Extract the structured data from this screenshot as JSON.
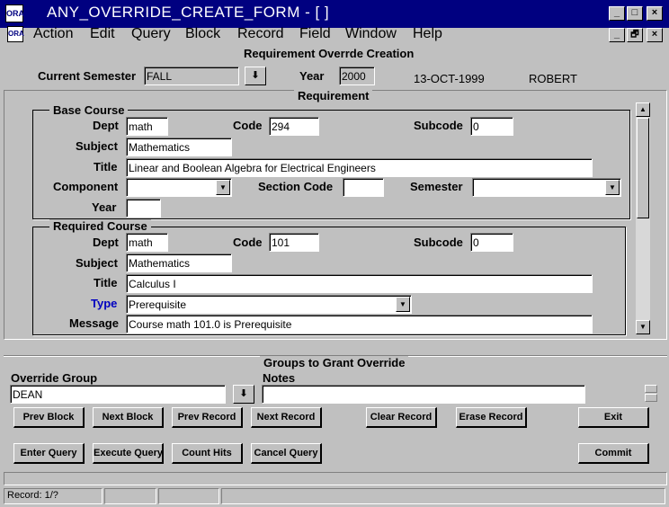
{
  "window": {
    "title": "ANY_OVERRIDE_CREATE_FORM - [ ]",
    "icon_name": "oracle-forms-icon",
    "controls": {
      "minimize": "_",
      "maximize": "□",
      "close": "×",
      "restore": "🗗"
    }
  },
  "menu": [
    "Action",
    "Edit",
    "Query",
    "Block",
    "Record",
    "Field",
    "Window",
    "Help"
  ],
  "form_title": "Requirement Overrde Creation",
  "header": {
    "semester_label": "Current Semester",
    "semester_value": "FALL",
    "year_label": "Year",
    "year_value": "2000",
    "date": "13-OCT-1999",
    "user": "ROBERT"
  },
  "requirement": {
    "title": "Requirement",
    "base_course": {
      "title": "Base Course",
      "dept_label": "Dept",
      "dept": "math",
      "code_label": "Code",
      "code": "294",
      "subcode_label": "Subcode",
      "subcode": "0",
      "subject_label": "Subject",
      "subject": "Mathematics",
      "title_label": "Title",
      "course_title": "Linear and Boolean Algebra for Electrical Engineers",
      "component_label": "Component",
      "component": "",
      "section_label": "Section Code",
      "section": "",
      "semester_label": "Semester",
      "semester": "",
      "year_label": "Year",
      "year": ""
    },
    "required_course": {
      "title": "Required Course",
      "dept_label": "Dept",
      "dept": "math",
      "code_label": "Code",
      "code": "101",
      "subcode_label": "Subcode",
      "subcode": "0",
      "subject_label": "Subject",
      "subject": "Mathematics",
      "title_label": "Title",
      "course_title": "Calculus I",
      "type_label": "Type",
      "type": "Prerequisite",
      "message_label": "Message",
      "message": "Course math 101.0 is Prerequisite"
    }
  },
  "groups": {
    "title": "Groups to Grant Override",
    "override_label": "Override Group",
    "override_value": "DEAN",
    "notes_label": "Notes",
    "notes_value": ""
  },
  "buttons": {
    "prev_block": "Prev Block",
    "next_block": "Next Block",
    "prev_record": "Prev Record",
    "next_record": "Next Record",
    "clear_record": "Clear Record",
    "erase_record": "Erase Record",
    "exit": "Exit",
    "enter_query": "Enter Query",
    "execute_query": "Execute Query",
    "count_hits": "Count Hits",
    "cancel_query": "Cancel Query",
    "commit": "Commit"
  },
  "status": {
    "record": "Record: 1/?"
  },
  "colors": {
    "titlebar": "#000080",
    "face": "#c0c0c0",
    "type_label": "#0000c0"
  }
}
